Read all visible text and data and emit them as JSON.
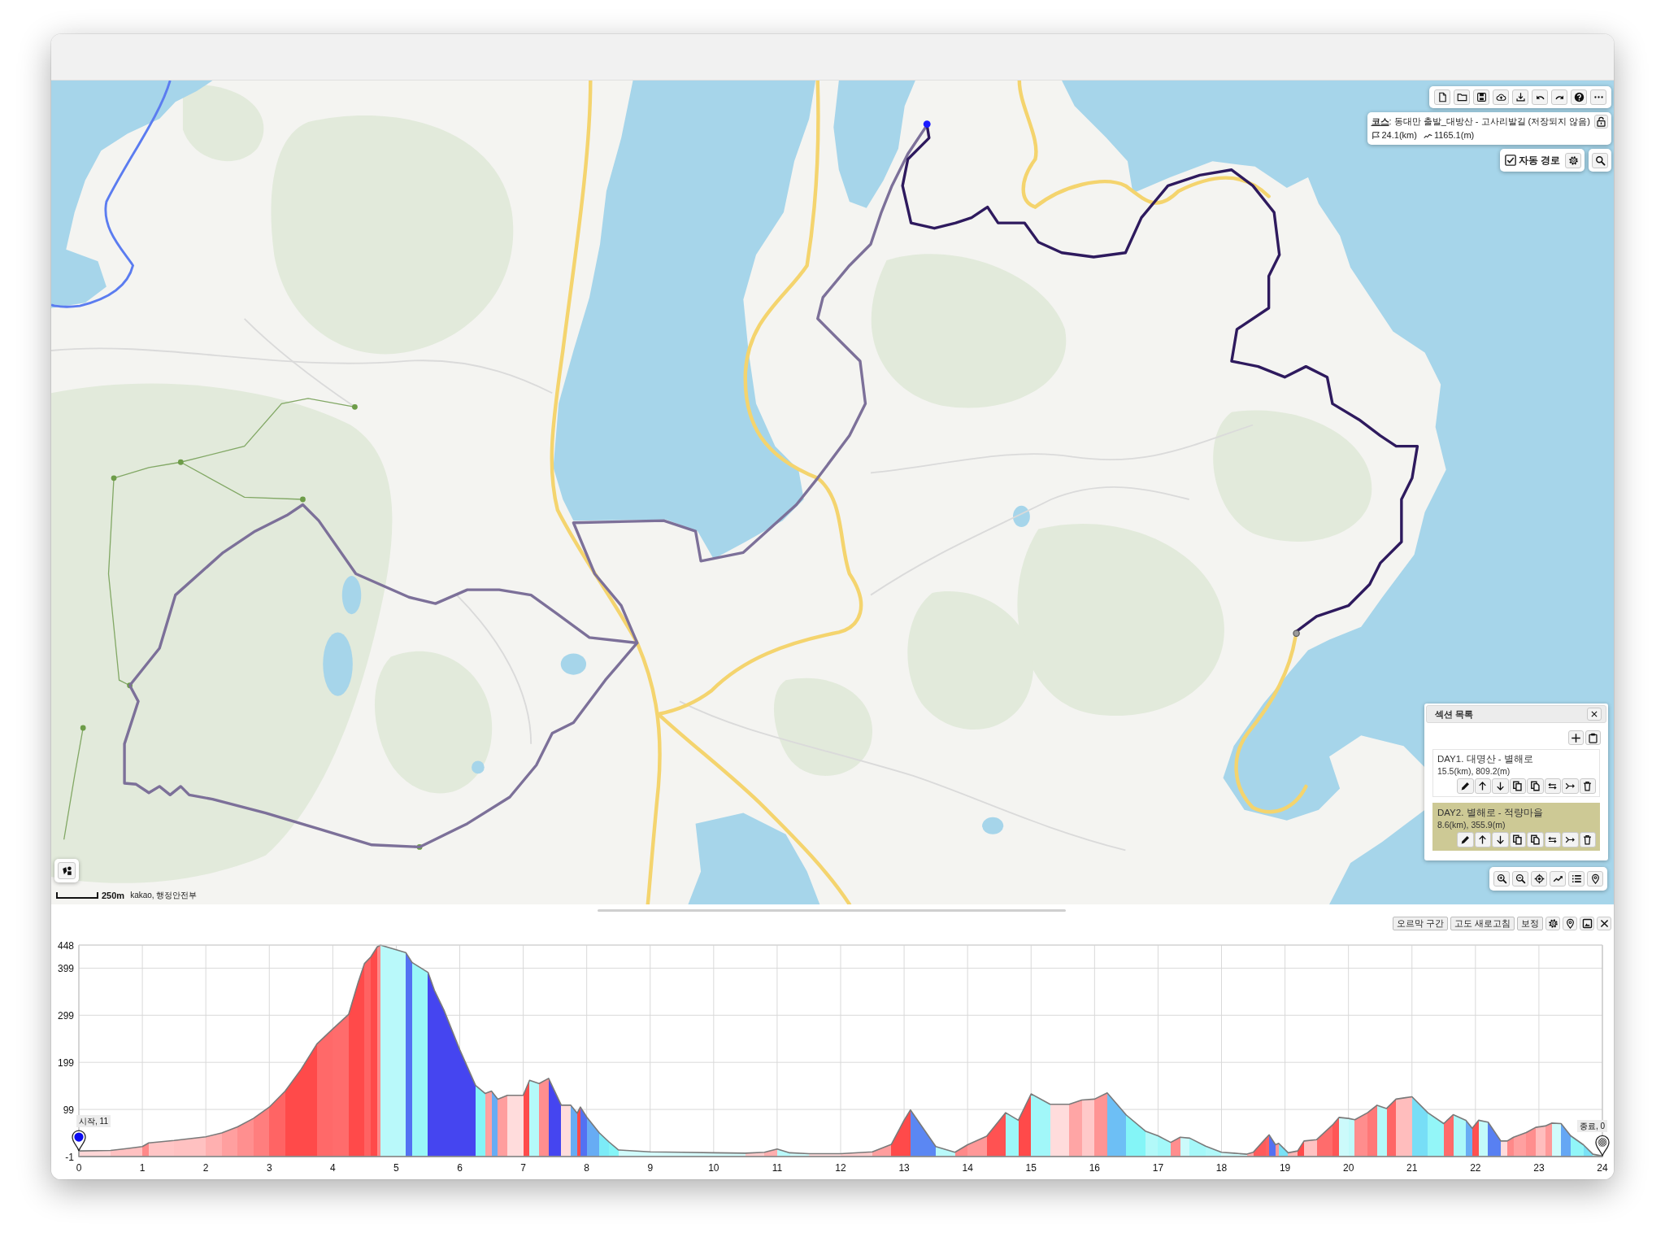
{
  "map": {
    "course": {
      "title": "**코스**: 동대만 출발_대방산 - 고사리발길 (저장되지 않음)",
      "distance": "24.1(km)",
      "ascent": "1165.1(m)"
    },
    "auto_route": {
      "label": "자동 경로",
      "checked": true
    },
    "sections": {
      "title": "섹션 목록",
      "items": [
        {
          "name": "DAY1. 대명산 - 별해로",
          "stats": "15.5(km), 809.2(m)",
          "selected": false
        },
        {
          "name": "DAY2. 별해로 - 적량마을",
          "stats": "8.6(km), 355.9(m)",
          "selected": true
        }
      ]
    },
    "scale": "250m",
    "attribution": "kakao, 행정안전부"
  },
  "elevation": {
    "buttons": [
      "오르막 구간",
      "고도 새로고침",
      "보정"
    ],
    "markers": [
      {
        "kind": "start",
        "label": "시작, 11"
      },
      {
        "kind": "end",
        "label": "종료, 0"
      }
    ],
    "chart_data": {
      "type": "area",
      "x": [
        0,
        0.5,
        0.75,
        1.0,
        1.1,
        1.5,
        1.75,
        2.0,
        2.25,
        2.5,
        2.75,
        3.0,
        3.25,
        3.5,
        3.75,
        4.0,
        4.25,
        4.4,
        4.5,
        4.6,
        4.7,
        4.75,
        5.0,
        5.15,
        5.25,
        5.5,
        5.6,
        5.75,
        6.0,
        6.25,
        6.4,
        6.5,
        6.6,
        6.75,
        6.9,
        7.0,
        7.1,
        7.25,
        7.4,
        7.6,
        7.75,
        7.85,
        7.9,
        8.0,
        8.2,
        8.35,
        8.5,
        9.0,
        9.5,
        10.0,
        10.5,
        10.8,
        11.0,
        11.2,
        11.5,
        12.0,
        12.5,
        12.8,
        13.0,
        13.1,
        13.5,
        13.8,
        14.0,
        14.3,
        14.6,
        14.8,
        15.0,
        15.3,
        15.6,
        15.8,
        16.0,
        16.2,
        16.5,
        16.8,
        17.0,
        17.2,
        17.35,
        17.5,
        17.75,
        18.0,
        18.2,
        18.4,
        18.5,
        18.7,
        18.75,
        18.85,
        18.9,
        19.05,
        19.2,
        19.3,
        19.5,
        19.75,
        19.85,
        20.0,
        20.1,
        20.3,
        20.45,
        20.6,
        20.75,
        20.9,
        21.0,
        21.25,
        21.5,
        21.65,
        21.85,
        21.95,
        22.05,
        22.2,
        22.4,
        22.5,
        22.6,
        22.8,
        22.95,
        23.1,
        23.2,
        23.35,
        23.5,
        23.7,
        23.85,
        24.0
      ],
      "values": [
        11,
        12,
        16,
        20,
        28,
        33,
        37,
        41,
        49,
        62,
        80,
        104,
        138,
        184,
        238,
        270,
        301,
        369,
        409,
        423,
        444,
        448,
        438,
        432,
        411,
        390,
        352,
        310,
        226,
        150,
        133,
        138,
        121,
        129,
        129,
        129,
        161,
        154,
        165,
        108,
        108,
        91,
        104,
        83,
        49,
        30,
        13,
        9,
        8,
        7,
        6,
        8,
        15,
        7,
        5,
        5,
        9,
        25,
        76,
        98,
        20,
        8,
        24,
        42,
        92,
        76,
        132,
        110,
        110,
        119,
        121,
        134,
        87,
        53,
        43,
        29,
        40,
        38,
        21,
        8,
        6,
        4,
        8,
        38,
        45,
        24,
        27,
        7,
        11,
        32,
        35,
        66,
        82,
        80,
        77,
        92,
        108,
        101,
        121,
        124,
        126,
        92,
        69,
        88,
        76,
        59,
        76,
        72,
        32,
        32,
        40,
        50,
        61,
        64,
        70,
        69,
        43,
        24,
        4,
        0
      ],
      "xlim": [
        0,
        24
      ],
      "ylim": [
        -1,
        448
      ],
      "xticks": [
        0,
        1,
        2,
        3,
        4,
        5,
        6,
        7,
        8,
        9,
        10,
        11,
        12,
        13,
        14,
        15,
        16,
        17,
        18,
        19,
        20,
        21,
        22,
        23,
        24
      ],
      "yticks": [
        -1,
        99,
        199,
        299,
        399,
        448
      ],
      "grid": true
    }
  }
}
